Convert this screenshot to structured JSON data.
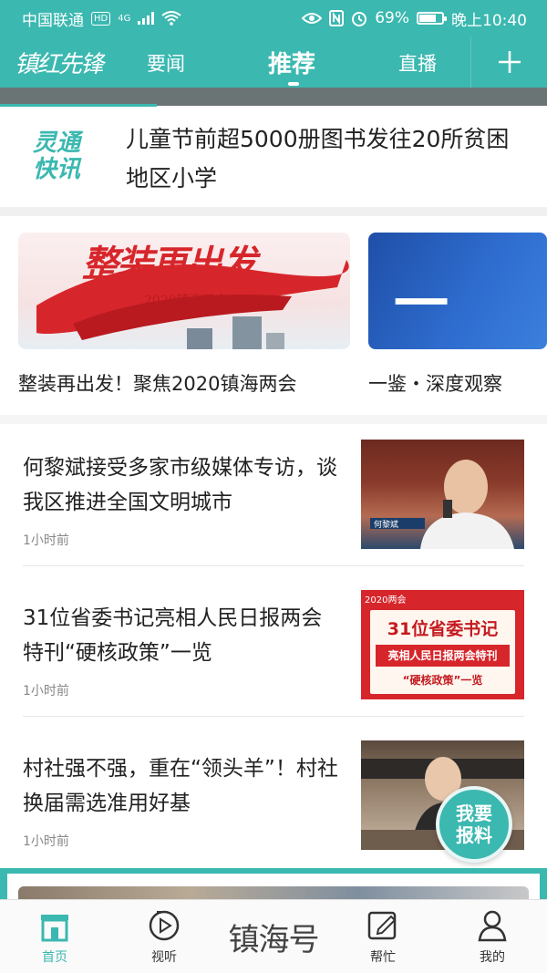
{
  "status_bar": {
    "carrier": "中国联通",
    "hd": "HD",
    "network": "4G",
    "battery": "69%",
    "battery_level": 0.69,
    "time": "晚上10:40"
  },
  "nav": {
    "logo": "镇红先锋",
    "tabs": [
      {
        "label": "要闻",
        "active": false
      },
      {
        "label": "推荐",
        "active": true
      },
      {
        "label": "直播",
        "active": false
      }
    ],
    "plus": "+"
  },
  "ticker": {
    "text": ""
  },
  "flash": {
    "logo_line1": "灵通",
    "logo_line2": "快讯",
    "headline": "儿童节前超5000册图书发往20所贫困地区小学"
  },
  "carousel": [
    {
      "title": "整装再出发！聚焦2020镇海两会",
      "banner_big": "整装再出发",
      "banner_small": "2020镇海两会"
    },
    {
      "title": "一鉴・深度观察",
      "banner_big": "一 鉴"
    }
  ],
  "news": [
    {
      "title": "何黎斌接受多家市级媒体专访，谈我区推进全国文明城市",
      "time": "1小时前",
      "thumb_caption": "何黎斌"
    },
    {
      "title": "31位省委书记亮相人民日报两会特刊“硬核政策”一览",
      "time": "1小时前",
      "thumb_line1": "31位省委书记",
      "thumb_line2": "亮相人民日报两会特刊",
      "thumb_line3": "“硬核政策”一览",
      "thumb_tag": "2020两会"
    },
    {
      "title": "村社强不强，重在“领头羊”！村社换届需选准用好基",
      "time": "1小时前"
    }
  ],
  "fab": {
    "line1": "我要",
    "line2": "报料"
  },
  "tabbar": {
    "items": [
      {
        "label": "首页",
        "icon": "home-icon",
        "active": true
      },
      {
        "label": "视听",
        "icon": "play-icon",
        "active": false
      },
      {
        "label": "帮忙",
        "icon": "edit-icon",
        "active": false
      },
      {
        "label": "我的",
        "icon": "user-icon",
        "active": false
      }
    ],
    "center_brand": "镇海号"
  },
  "colors": {
    "accent": "#3bb8b0",
    "banner_red": "#d7262b"
  }
}
